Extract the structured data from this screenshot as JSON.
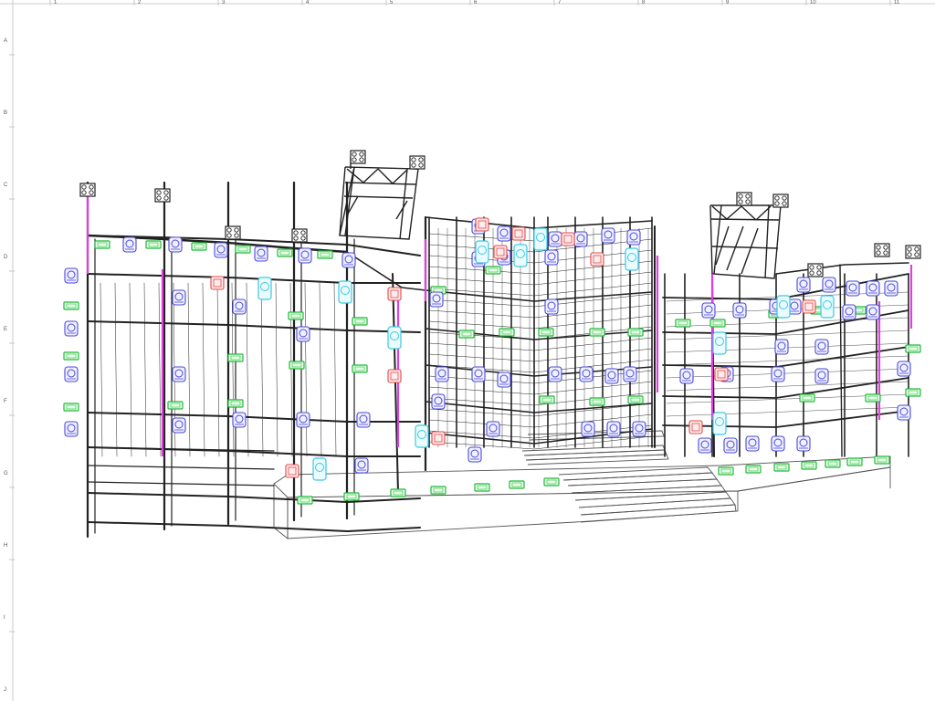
{
  "ruler": {
    "columns": [
      "1",
      "2",
      "3",
      "4",
      "5",
      "6",
      "7",
      "8",
      "9",
      "10",
      "11"
    ],
    "rows": [
      "A",
      "B",
      "C",
      "D",
      "E",
      "F",
      "G",
      "H",
      "I",
      "J"
    ]
  },
  "colors": {
    "scaffold": "#222222",
    "fixture_blue": "#4a4ad8",
    "fixture_green": "#22b83a",
    "fixture_red": "#e04848",
    "fixture_cyan": "#3cc8e0",
    "fixture_magenta": "#e040e0",
    "stage_outline": "#555555",
    "ruler_line": "#bbbbbb"
  },
  "drawing": {
    "name": "stage-scaffolding-lighting-rig",
    "fixture_types": [
      "moving-head-spot",
      "led-batten",
      "wash-light",
      "strobe",
      "vertical-led-bar",
      "blinder"
    ]
  }
}
